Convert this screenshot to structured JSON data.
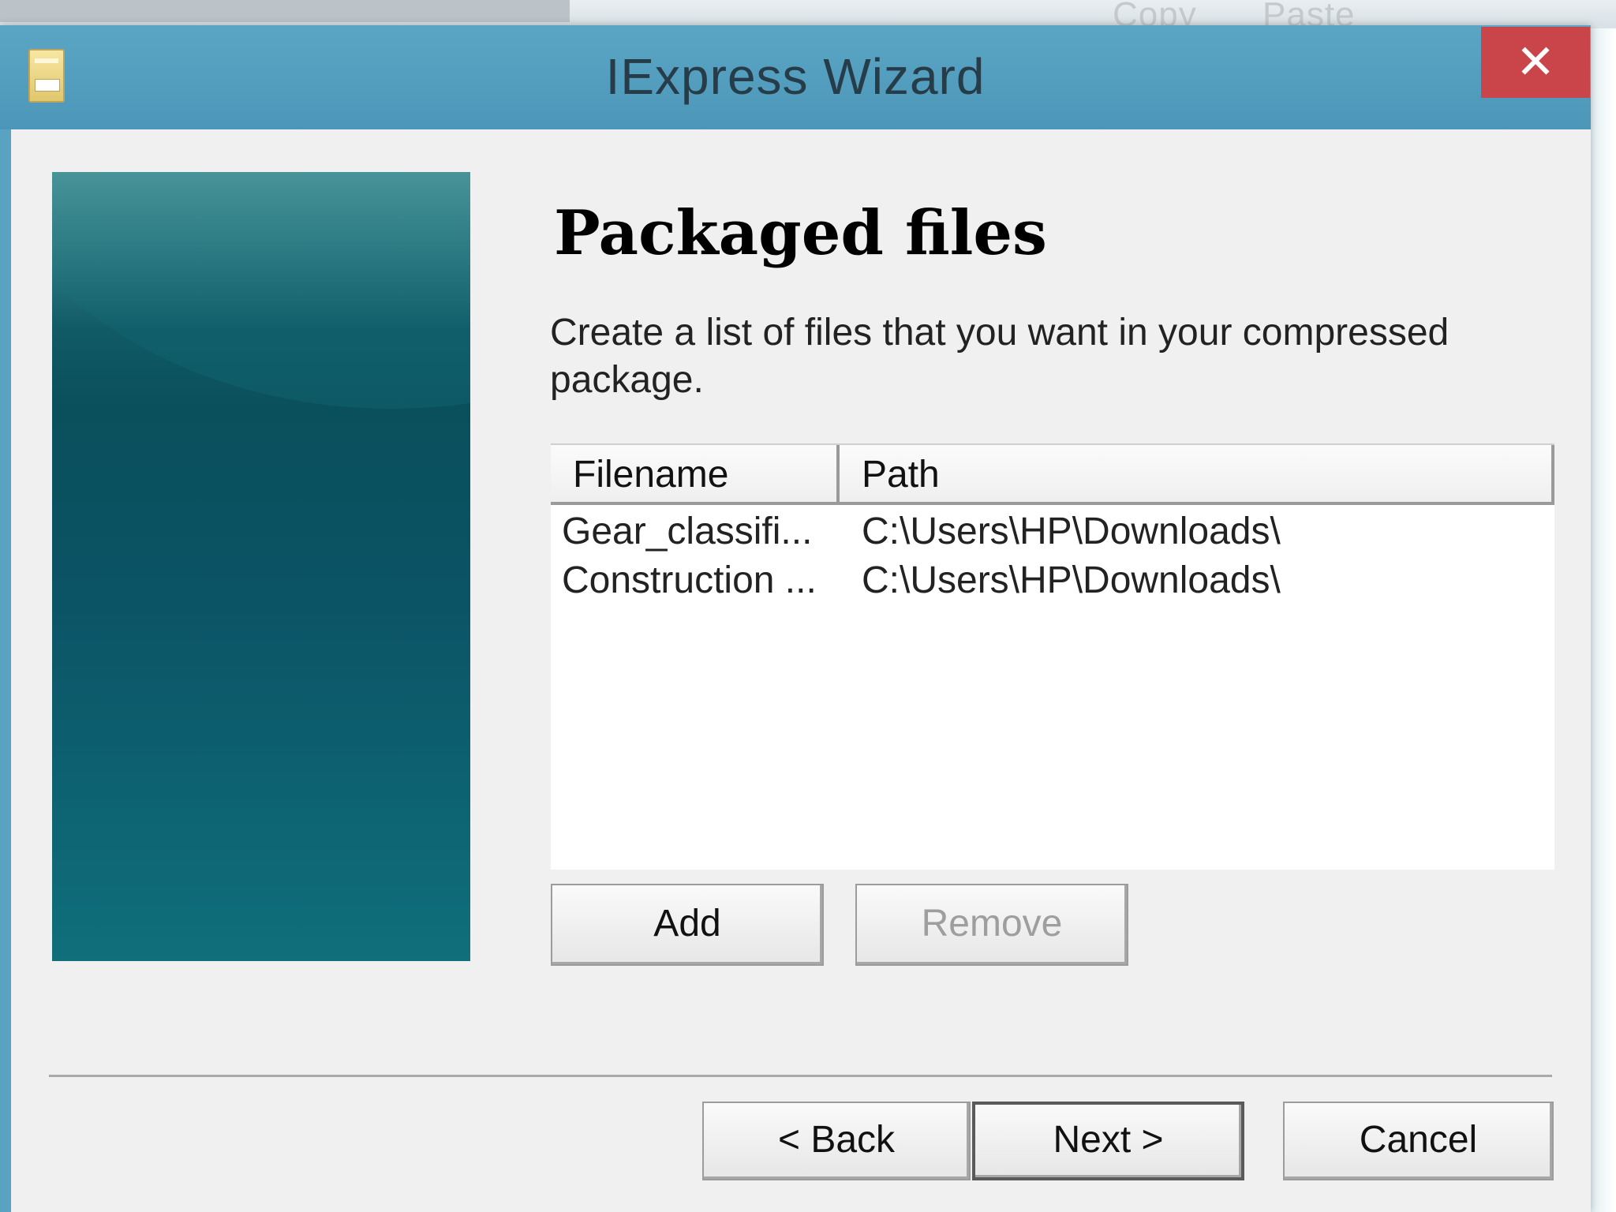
{
  "window": {
    "title": "IExpress Wizard",
    "close_glyph": "✕"
  },
  "background": {
    "menu_copy": "Copy",
    "menu_paste": "Paste"
  },
  "page": {
    "heading": "Packaged files",
    "description": "Create a list of files that you want in your compressed package."
  },
  "file_list": {
    "columns": [
      "Filename",
      "Path"
    ],
    "rows": [
      [
        "Gear_classifi...",
        "C:\\Users\\HP\\Downloads\\"
      ],
      [
        "Construction ...",
        "C:\\Users\\HP\\Downloads\\"
      ]
    ]
  },
  "list_buttons": {
    "add": "Add",
    "remove": "Remove"
  },
  "nav_buttons": {
    "back": "< Back",
    "next": "Next >",
    "cancel": "Cancel"
  }
}
